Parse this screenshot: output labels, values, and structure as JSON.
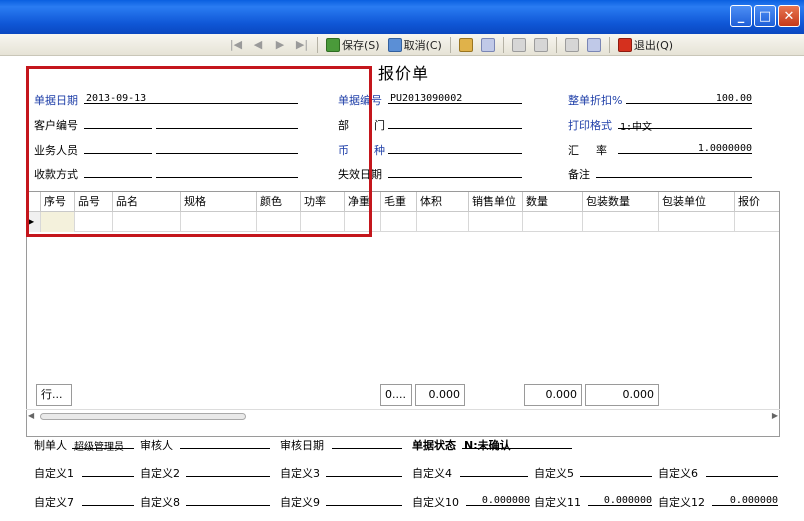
{
  "titlebar": {
    "min": "_",
    "max": "□",
    "close": "✕"
  },
  "toolbar": {
    "nav_first": "|◀",
    "nav_prev": "◀",
    "nav_next": "▶",
    "nav_last": "▶|",
    "save": "保存(S)",
    "cancel": "取消(C)",
    "exit": "退出(Q)"
  },
  "form": {
    "title": "报价单",
    "doc_date_label": "单据日期",
    "doc_date": "2013-09-13",
    "doc_no_label": "单据编号",
    "doc_no": "PU2013090002",
    "discount_label": "整单折扣%",
    "discount": "100.00",
    "customer_label": "客户编号",
    "dept_label_a": "部",
    "dept_label_b": "门",
    "print_label": "打印格式",
    "print_value": "1:中文",
    "sales_label": "业务人员",
    "currency_label_a": "币",
    "currency_label_b": "种",
    "rate_label_a": "汇",
    "rate_label_b": "率",
    "rate": "1.0000000",
    "payment_label": "收款方式",
    "expire_label": "失效日期",
    "remark_label": "备注"
  },
  "grid": {
    "columns": [
      "序号",
      "品号",
      "品名",
      "规格",
      "颜色",
      "功率",
      "净重",
      "毛重",
      "体积",
      "销售单位",
      "数量",
      "包装数量",
      "包装单位",
      "报价"
    ],
    "totals": {
      "row_btn": "行...",
      "a": "0....",
      "b": "0.000",
      "c": "0.000",
      "d": "0.000"
    }
  },
  "footer": {
    "maker_label": "制单人",
    "maker": "超级管理员",
    "auditor_label": "审核人",
    "audit_date_label": "审核日期",
    "status_label": "单据状态",
    "status_value": "N:未确认",
    "def1": "自定义1",
    "def2": "自定义2",
    "def3": "自定义3",
    "def4": "自定义4",
    "def5": "自定义5",
    "def6": "自定义6",
    "def7": "自定义7",
    "def8": "自定义8",
    "def9": "自定义9",
    "def10": "自定义10",
    "def10_val": "0.000000",
    "def11": "自定义11",
    "def11_val": "0.000000",
    "def12": "自定义12",
    "def12_val": "0.000000"
  }
}
